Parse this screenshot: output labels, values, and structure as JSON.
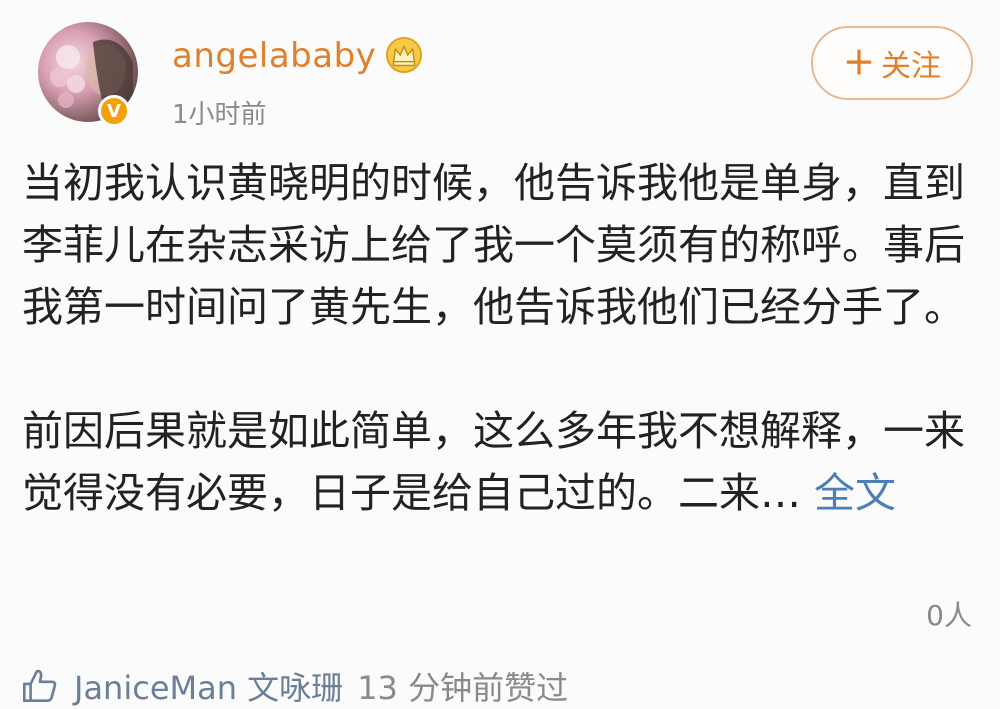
{
  "post": {
    "username": "angelababy",
    "timestamp": "1小时前",
    "follow_label": "关注",
    "paragraph1": "当初我认识黄晓明的时候，他告诉我他是单身，直到李菲儿在杂志采访上给了我一个莫须有的称呼。事后我第一时间问了黄先生，他告诉我他们已经分手了。",
    "paragraph2_text": "前因后果就是如此简单，这么多年我不想解释，一来觉得没有必要，日子是给自己过的。二来… ",
    "full_text_link": "全文",
    "view_count": "0人"
  },
  "like": {
    "user": "JaniceMan 文咏珊",
    "suffix": "13 分钟前赞过"
  },
  "colors": {
    "username": "#e07f2c",
    "link": "#4a7fb8",
    "verified_badge": "#f3a10a",
    "like_user": "#6b7f99"
  },
  "icons": [
    "avatar",
    "verified-badge-icon",
    "crown-icon",
    "plus-icon",
    "thumbs-up-icon"
  ]
}
